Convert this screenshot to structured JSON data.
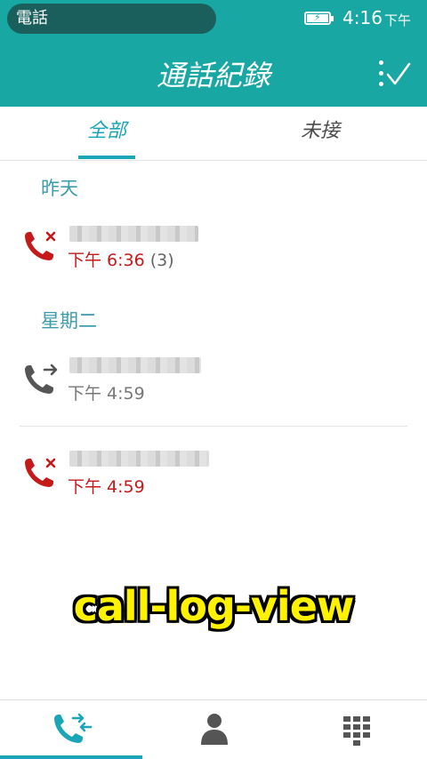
{
  "status_bar": {
    "app_name": "電話",
    "time": "4:16",
    "ampm": "下午"
  },
  "header": {
    "title": "通話紀錄"
  },
  "tabs": [
    {
      "label": "全部"
    },
    {
      "label": "未接"
    }
  ],
  "sections": [
    {
      "label": "昨天",
      "entries": [
        {
          "time": "下午 6:36",
          "count": "(3)",
          "type": "missed"
        }
      ]
    },
    {
      "label": "星期二",
      "entries": [
        {
          "time": "下午 4:59",
          "type": "outgoing"
        },
        {
          "time": "下午 4:59",
          "type": "missed"
        }
      ]
    }
  ],
  "overlay_label": "call-log-view",
  "colors": {
    "accent": "#19a7a3",
    "tab_active": "#1aa6b6",
    "missed": "#c51a1a"
  },
  "icons": [
    "battery-icon",
    "select-check-icon",
    "missed-call-icon",
    "outgoing-call-icon",
    "call-log-icon",
    "contacts-icon",
    "dialpad-icon"
  ]
}
